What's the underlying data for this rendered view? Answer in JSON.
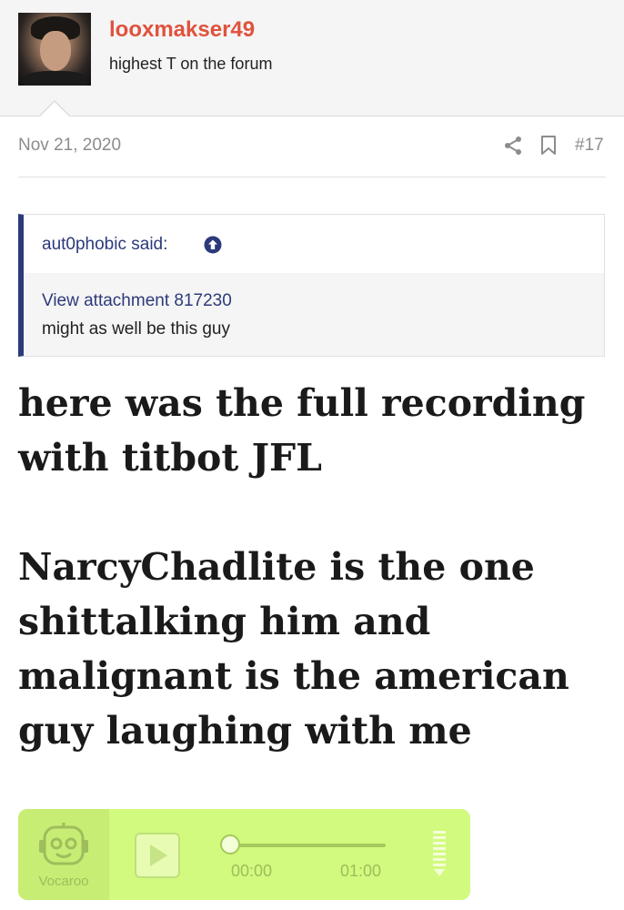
{
  "author": {
    "username": "looxmakser49",
    "title": "highest T on the forum",
    "avatar_icon": "avatar-photo"
  },
  "post_meta": {
    "date": "Nov 21, 2020",
    "number": "#17",
    "icons": [
      "share-icon",
      "bookmark-icon"
    ]
  },
  "quote": {
    "author_line": "aut0phobic said:",
    "icon": "arrow-up-circle-icon",
    "attachment_link": "View attachment 817230",
    "text": "might as well be this guy"
  },
  "post": {
    "paragraphs": [
      "here was the full recording with titbot JFL",
      "NarcyChadlite is the one shittalking him and malignant is the american guy laughing with me"
    ]
  },
  "audio_player": {
    "brand": "Vocaroo",
    "current_time": "00:00",
    "duration": "01:00",
    "progress": 0,
    "icons": [
      "vocaroo-logo-icon",
      "play-icon",
      "volume-icon"
    ],
    "colors": {
      "background": "#d2fa7e",
      "accent": "#a6c95c"
    }
  },
  "colors": {
    "username": "#e0523d",
    "quote_accent": "#2d3a7a",
    "meta_text": "#8c8c8c"
  }
}
